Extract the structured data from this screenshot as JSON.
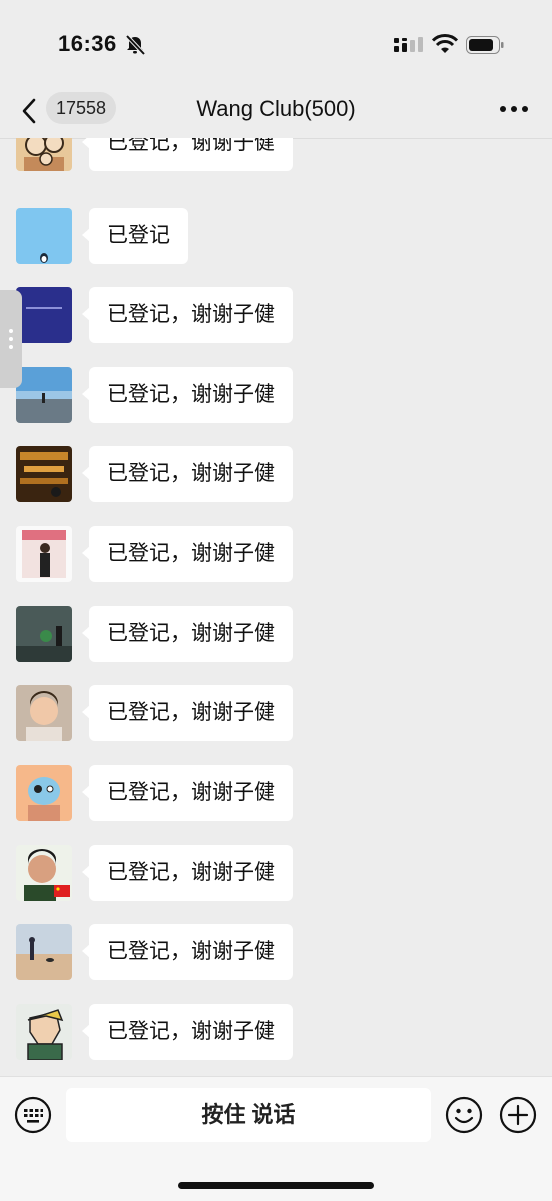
{
  "status_bar": {
    "time": "16:36",
    "icons": [
      "bell-muted-icon",
      "signal-icon",
      "wifi-icon",
      "battery-icon"
    ]
  },
  "nav": {
    "back_icon": "chevron-left-icon",
    "unread_count": "17558",
    "title": "Wang Club(500)",
    "more_icon": "more-icon"
  },
  "messages": [
    {
      "text": "已登记，谢谢子健",
      "avatar": "avatar-family-illustration"
    },
    {
      "text": "已登记",
      "avatar": "avatar-light-blue-penguin"
    },
    {
      "text": "已登记，谢谢子健",
      "avatar": "avatar-dark-blue"
    },
    {
      "text": "已登记，谢谢子健",
      "avatar": "avatar-beach-sky"
    },
    {
      "text": "已登记，谢谢子健",
      "avatar": "avatar-night-street"
    },
    {
      "text": "已登记，谢谢子健",
      "avatar": "avatar-woman-portrait"
    },
    {
      "text": "已登记，谢谢子健",
      "avatar": "avatar-office-stage"
    },
    {
      "text": "已登记，谢谢子健",
      "avatar": "avatar-child"
    },
    {
      "text": "已登记，谢谢子健",
      "avatar": "avatar-cartoon-cat"
    },
    {
      "text": "已登记，谢谢子健",
      "avatar": "avatar-boy-flag"
    },
    {
      "text": "已登记，谢谢子健",
      "avatar": "avatar-beach-walk"
    },
    {
      "text": "已登记，谢谢子健",
      "avatar": "avatar-cartoon-man"
    }
  ],
  "input_bar": {
    "hold_to_talk_label": "按住 说话",
    "icons": [
      "keyboard-icon",
      "emoji-icon",
      "plus-icon"
    ]
  },
  "colors": {
    "background": "#ededed",
    "bubble": "#ffffff",
    "input_bar": "#f6f6f6"
  }
}
